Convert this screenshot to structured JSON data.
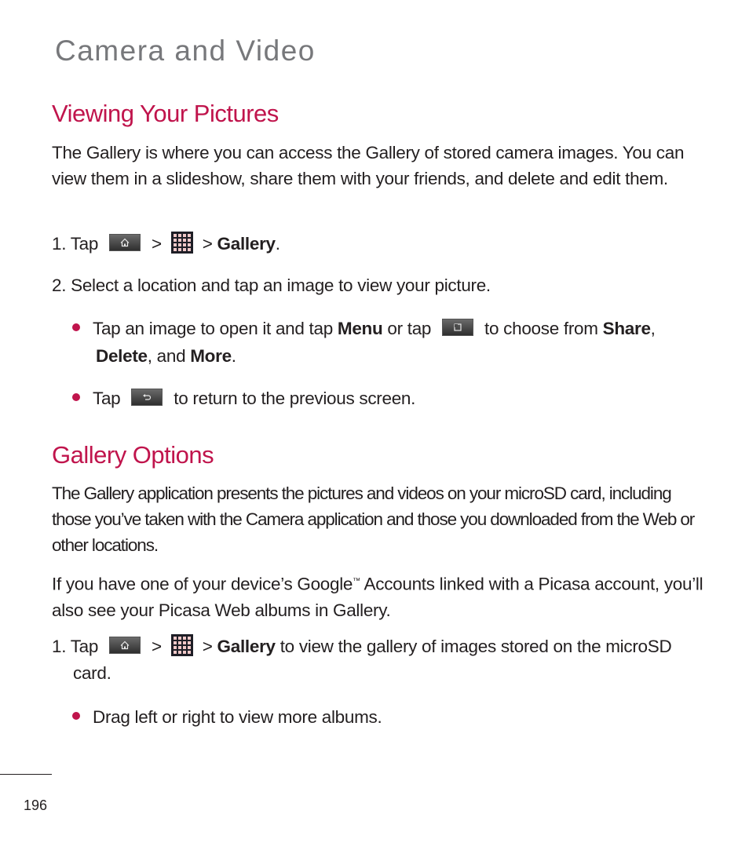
{
  "page": {
    "title": "Camera and Video",
    "page_number": "196"
  },
  "section1": {
    "heading": "Viewing Your Pictures",
    "intro": "The Gallery is where you can access the Gallery of stored camera images. You can view them in a slideshow, share them with your friends, and delete and edit them.",
    "step1": {
      "prefix": "1. Tap",
      "sep1": ">",
      "sep2": ">",
      "target": "Gallery",
      "end": "."
    },
    "step2": "2. Select a location and tap an image to view your picture.",
    "bullet1": {
      "part1": "Tap an image to open it and tap",
      "menu": "Menu",
      "part2": "or tap",
      "part3": "to choose from",
      "share": "Share",
      "comma": ",",
      "delete": "Delete",
      "and": ", and",
      "more": "More",
      "end": "."
    },
    "bullet2": {
      "prefix": "Tap",
      "suffix": "to return to the previous screen."
    }
  },
  "section2": {
    "heading": "Gallery Options",
    "para1": "The Gallery application presents the pictures and videos on your microSD card, including those you’ve taken with the Camera application and those you downloaded from the Web or other locations.",
    "para2_a": "If you have one of your device’s Google",
    "para2_tm": "™",
    "para2_b": " Accounts linked with a Picasa account, you’ll also see your Picasa Web albums in Gallery.",
    "step1": {
      "prefix": "1. Tap",
      "sep1": ">",
      "sep2": ">",
      "target": "Gallery",
      "rest": "to view the gallery of images stored on the microSD",
      "cont": "card."
    },
    "bullet1": "Drag left or right to view more albums."
  },
  "icons": {
    "home": "home-key-icon",
    "apps": "applications-grid-icon",
    "menu": "menu-key-icon",
    "back": "back-key-icon"
  },
  "colors": {
    "accent": "#c0144c",
    "title_gray": "#77787b",
    "body_text": "#231f20"
  }
}
